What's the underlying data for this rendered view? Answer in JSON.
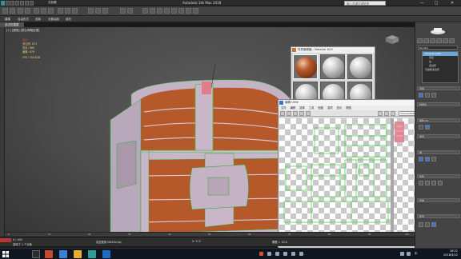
{
  "titlebar": {
    "title": "Autodesk 3ds Max 2018",
    "search_placeholder": "键入关键字或短语",
    "quick_file": "无标题",
    "minimize": "—",
    "maximize": "□",
    "close": "✕"
  },
  "ribbon": {
    "tabs": [
      "建模",
      "自由形式",
      "选择",
      "对象绘制",
      "填充"
    ]
  },
  "viewport": {
    "label": "[+] [透视] [默认明暗处理]",
    "sub_tab": "多边形建模",
    "stats": {
      "header": "总计",
      "polys_label": "多边形:",
      "polys_value": "872",
      "verts_label": "顶点:",
      "verts_value": "880",
      "faces_label": "面数:",
      "faces_value": "879"
    },
    "fps_label": "FPS:",
    "fps_value": "176.628"
  },
  "material_editor": {
    "title": "材质编辑器 - Material #25"
  },
  "uv_editor": {
    "title": "编辑 UVW",
    "menu": [
      "文件",
      "编辑",
      "选择",
      "工具",
      "贴图",
      "选项",
      "显示",
      "视图"
    ],
    "texture_dropdown": "CheckerPattern ( Checker )"
  },
  "command_panel": {
    "object_name": "Box001",
    "modifier_list_label": "修改器列表",
    "stack": [
      "Unwrap UVW",
      "顶点",
      "边",
      "多边形",
      "可编辑多边形"
    ],
    "selected_index": 0,
    "rollouts": [
      "选择",
      "材质ID",
      "编辑 UV",
      "通道",
      "剥",
      "投影",
      "包裹",
      "配置"
    ]
  },
  "timeline": {
    "frame_label": "0 / 100",
    "ticks": [
      "0",
      "10",
      "20",
      "30",
      "40",
      "50",
      "60",
      "70",
      "80",
      "90",
      "100"
    ]
  },
  "status": {
    "selection": "选择了 1 个对象",
    "script": "欢迎使用 MAXScript。",
    "coords": "X:  Y:  Z:",
    "grid": "栅格 = 10.0"
  },
  "taskbar": {
    "time": "16:21",
    "date": "2018/3/22",
    "lang": "中"
  },
  "colors": {
    "wood": "#b5582a",
    "metal": "#c9b6c8",
    "uv_wire": "#3ad23a",
    "selection_blue": "#6aa6d8"
  }
}
